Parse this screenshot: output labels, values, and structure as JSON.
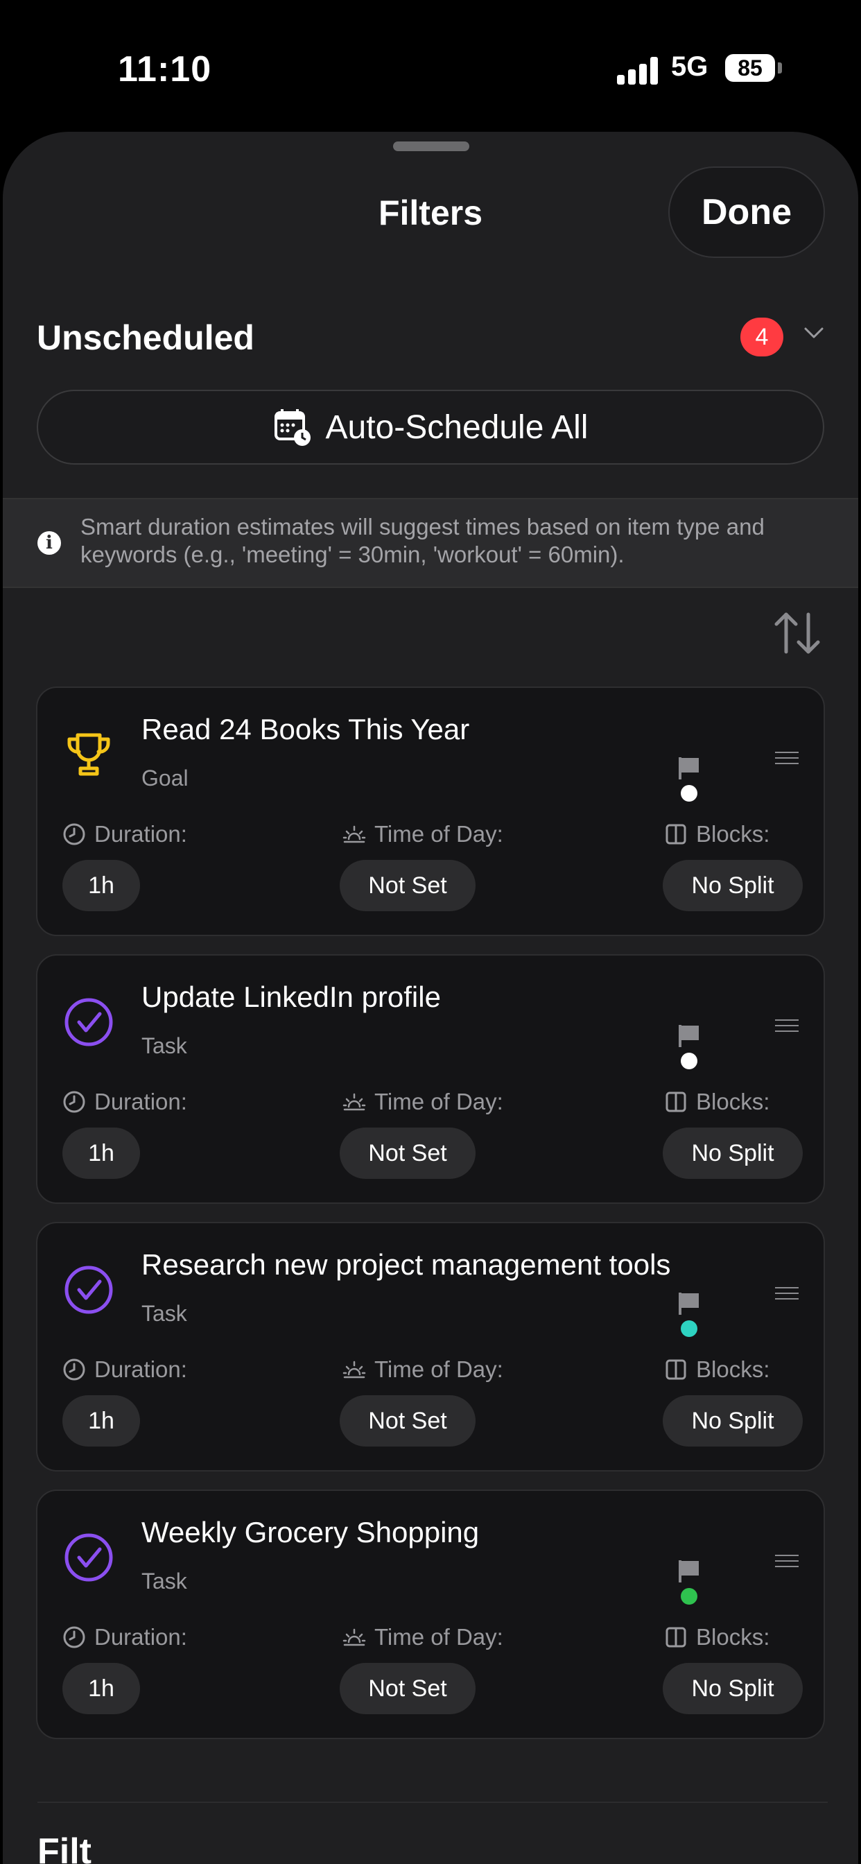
{
  "status_bar": {
    "time": "11:10",
    "network": "5G",
    "battery": "85"
  },
  "sheet": {
    "title": "Filters",
    "done_label": "Done"
  },
  "section": {
    "title": "Unscheduled",
    "count": "4"
  },
  "auto_schedule": {
    "label": "Auto-Schedule All"
  },
  "info": {
    "text": "Smart duration estimates will suggest times based on item type and keywords (e.g., 'meeting' = 30min, 'workout' = 60min)."
  },
  "labels": {
    "duration": "Duration:",
    "time_of_day": "Time of Day:",
    "blocks": "Blocks:"
  },
  "items": [
    {
      "title": "Read 24 Books This Year",
      "type": "Goal",
      "icon": "trophy-icon",
      "duration": "1h",
      "time_of_day": "Not Set",
      "blocks": "No Split",
      "priority_color": "#ffffff"
    },
    {
      "title": "Update LinkedIn profile",
      "type": "Task",
      "icon": "check-circle-icon",
      "duration": "1h",
      "time_of_day": "Not Set",
      "blocks": "No Split",
      "priority_color": "#ffffff"
    },
    {
      "title": "Research new project management tools",
      "type": "Task",
      "icon": "check-circle-icon",
      "duration": "1h",
      "time_of_day": "Not Set",
      "blocks": "No Split",
      "priority_color": "#2ed3c1"
    },
    {
      "title": "Weekly Grocery Shopping",
      "type": "Task",
      "icon": "check-circle-icon",
      "duration": "1h",
      "time_of_day": "Not Set",
      "blocks": "No Split",
      "priority_color": "#2fc24f"
    }
  ],
  "footer": {
    "partial_label": "Filt"
  },
  "colors": {
    "accent": "#8b4ff0",
    "goal": "#f5c518",
    "badge": "#ff3b41",
    "background": "#1f1f21"
  }
}
